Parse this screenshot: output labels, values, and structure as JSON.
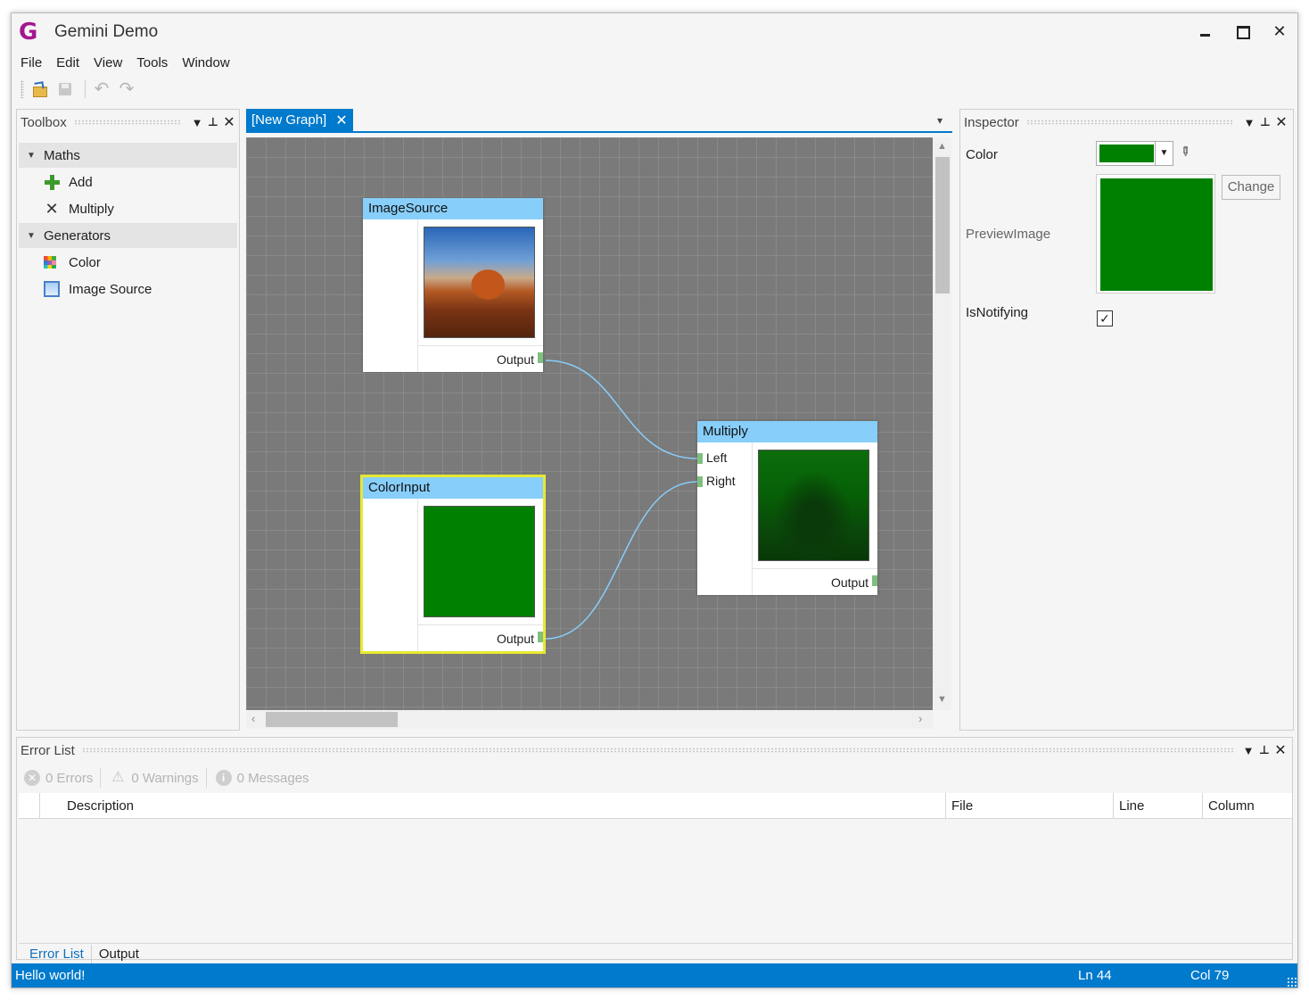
{
  "app": {
    "logo": "G",
    "title": "Gemini Demo",
    "minimize": "",
    "maximize": "",
    "close": "✕"
  },
  "menu": [
    "File",
    "Edit",
    "View",
    "Tools",
    "Window"
  ],
  "toolbar": {
    "undo": "↶",
    "redo": "↷"
  },
  "toolbox": {
    "title": "Toolbox",
    "groups": [
      {
        "label": "Maths",
        "items": [
          "Add",
          "Multiply"
        ]
      },
      {
        "label": "Generators",
        "items": [
          "Color",
          "Image Source"
        ]
      }
    ],
    "icons": [
      "add-icon",
      "multiply-icon",
      "color-palette-icon",
      "image-icon"
    ]
  },
  "document": {
    "tab_label": "[New Graph]",
    "tab_close": "✕",
    "nodes": [
      {
        "title": "ImageSource",
        "output": "Output"
      },
      {
        "title": "ColorInput",
        "output": "Output",
        "color": "#008000"
      },
      {
        "title": "Multiply",
        "inputs": [
          "Left",
          "Right"
        ],
        "output": "Output"
      }
    ],
    "connection_color": "#87cefa",
    "header_color": "#87cefa"
  },
  "inspector": {
    "title": "Inspector",
    "properties": [
      {
        "label": "Color",
        "value": "#008000"
      },
      {
        "label": "PreviewImage",
        "button": "Change"
      },
      {
        "label": "IsNotifying",
        "checked": true,
        "mark": "✓"
      }
    ]
  },
  "error_list": {
    "title": "Error List",
    "filters": [
      "0 Errors",
      "0 Warnings",
      "0 Messages"
    ],
    "columns": [
      "",
      "Description",
      "File",
      "Line",
      "Column"
    ],
    "tabs": [
      "Error List",
      "Output"
    ]
  },
  "status": {
    "text": "Hello world!",
    "line": "Ln 44",
    "column": "Col 79"
  },
  "colors": {
    "accent": "#007acc",
    "node_header": "#87cefa",
    "selection": "#e8e832",
    "green": "#008000"
  }
}
